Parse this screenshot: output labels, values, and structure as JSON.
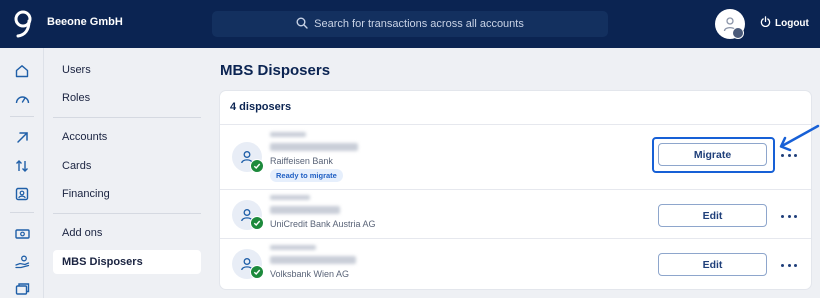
{
  "header": {
    "company": "Beeone GmbH",
    "search_placeholder": "Search for transactions across all accounts",
    "logout_label": "Logout"
  },
  "rail_icons": [
    "home-icon",
    "gauge-icon",
    "arrow-up-right-icon",
    "transfer-arrows-icon",
    "id-card-icon",
    "banknote-icon",
    "hand-coins-icon",
    "cards-stack-icon"
  ],
  "sidenav": {
    "items": [
      {
        "label": "Users"
      },
      {
        "label": "Roles"
      },
      {
        "label": "Accounts"
      },
      {
        "label": "Cards"
      },
      {
        "label": "Financing"
      },
      {
        "label": "Add ons"
      },
      {
        "label": "MBS Disposers",
        "active": true
      }
    ]
  },
  "main": {
    "title": "MBS Disposers",
    "count_label": "4 disposers",
    "disposers": [
      {
        "bank": "Raiffeisen Bank",
        "status": "Ready to migrate",
        "action": "Migrate"
      },
      {
        "bank": "UniCredit Bank Austria AG",
        "action": "Edit"
      },
      {
        "bank": "Volksbank Wien AG",
        "action": "Edit"
      }
    ]
  },
  "colors": {
    "header_bg": "#0b2452",
    "accent": "#1760d6",
    "success": "#1d8a3c"
  }
}
